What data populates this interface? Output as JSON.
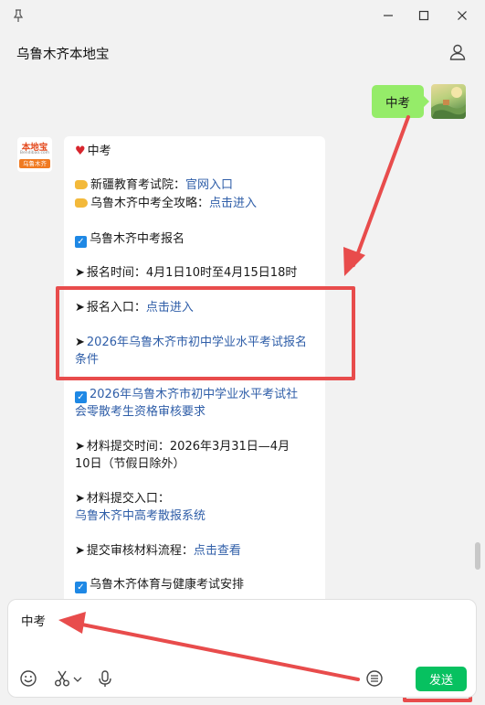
{
  "window": {
    "title": "乌鲁木齐本地宝"
  },
  "messages": {
    "user": {
      "text": "中考"
    },
    "bot": {
      "avatar": {
        "brand": "本地宝",
        "site": "Bendibao.com",
        "city": "乌鲁木齐"
      },
      "heading": "中考",
      "items": [
        {
          "prefix": "新疆教育考试院：",
          "link": "官网入口"
        },
        {
          "prefix": "乌鲁木齐中考全攻略：",
          "link": "点击进入"
        }
      ],
      "section1": "乌鲁木齐中考报名",
      "reg_time": "报名时间：4月1日10时至4月15日18时",
      "reg_entry_prefix": "报名入口：",
      "reg_entry_link": "点击进入",
      "conditions_link_1": "2026年乌鲁木齐市初中学业水平考试报名",
      "conditions_link_2": "条件",
      "section2_link_1": "2026年乌鲁木齐市初中学业水平考试社",
      "section2_link_2": "会零散考生资格审核要求",
      "material_time_1": "材料提交时间：2026年3月31日—4月",
      "material_time_2": "10日（节假日除外）",
      "material_entry": "材料提交入口：",
      "material_entry_link": "乌鲁木齐中高考散报系统",
      "process_prefix": "提交审核材料流程：",
      "process_link": "点击查看",
      "section3": "乌鲁木齐体育与健康考试安排"
    }
  },
  "composer": {
    "value": "中考",
    "send_label": "发送"
  },
  "icons": {
    "pin": "pin-icon",
    "minimize": "minimize-icon",
    "maximize": "maximize-icon",
    "close": "close-icon",
    "person": "person-icon",
    "emoji": "emoji-icon",
    "scissors": "scissors-icon",
    "chevron": "chevron-down-icon",
    "mic": "microphone-icon",
    "list": "list-icon"
  },
  "colors": {
    "accent": "#07c160",
    "user_bubble": "#95ec69",
    "link": "#2f5ea8",
    "annotation": "#e84c4c"
  }
}
